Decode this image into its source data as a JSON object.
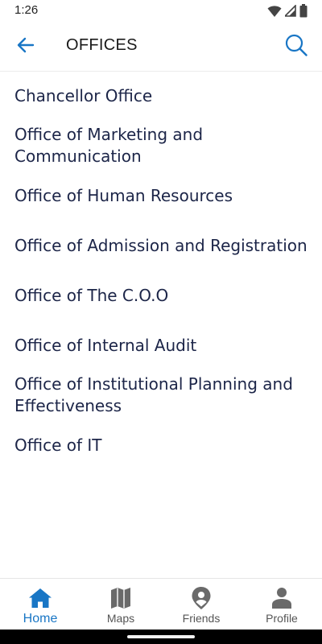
{
  "status_bar": {
    "time": "1:26",
    "icons": [
      "wifi-icon",
      "cell-signal-icon",
      "battery-icon"
    ]
  },
  "app_bar": {
    "title": "OFFICES",
    "back_icon": "arrow-left-icon",
    "search_icon": "search-icon",
    "accent_color": "#1976c5"
  },
  "offices": [
    "Chancellor Office",
    "Office of Marketing and Communication",
    "Office of Human Resources",
    "Office of Admission and Registration",
    "Office of The C.O.O",
    "Office of Internal Audit",
    "Office of Institutional Planning and Effectiveness",
    "Office of IT"
  ],
  "bottom_nav": {
    "active": "Home",
    "items": [
      {
        "label": "Home",
        "icon": "home-icon"
      },
      {
        "label": "Maps",
        "icon": "map-icon"
      },
      {
        "label": "Friends",
        "icon": "location-pin-icon"
      },
      {
        "label": "Profile",
        "icon": "person-icon"
      }
    ]
  },
  "colors": {
    "text_primary": "#1c2548",
    "accent": "#1976c5",
    "nav_inactive": "#555555"
  }
}
